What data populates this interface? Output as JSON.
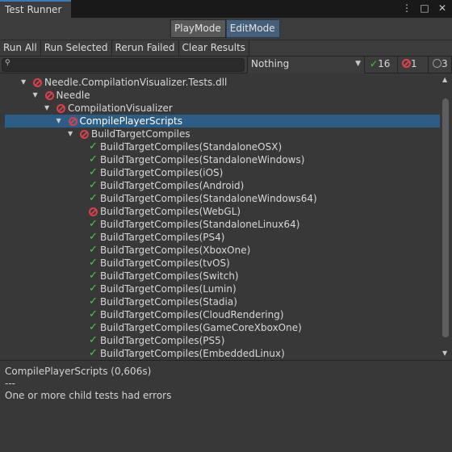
{
  "window": {
    "tab_title": "Test Runner",
    "icons": [
      "more-vertical-icon",
      "maximize-icon",
      "close-icon"
    ]
  },
  "modes": {
    "playmode": "PlayMode",
    "editmode": "EditMode",
    "active": "EditMode"
  },
  "toolbar": {
    "run_all": "Run All",
    "run_selected": "Run Selected",
    "rerun_failed": "Rerun Failed",
    "clear_results": "Clear Results"
  },
  "filter": {
    "search_value": "",
    "category_selected": "Nothing",
    "passed_count": "16",
    "failed_count": "1",
    "skipped_count": "3"
  },
  "tree": [
    {
      "label": "Needle.CompilationVisualizer.Tests.dll",
      "status": "failed",
      "expanded": true
    },
    {
      "label": "Needle",
      "status": "failed",
      "expanded": true
    },
    {
      "label": "CompilationVisualizer",
      "status": "failed",
      "expanded": true
    },
    {
      "label": "CompilePlayerScripts",
      "status": "failed",
      "expanded": true,
      "selected": true
    },
    {
      "label": "BuildTargetCompiles",
      "status": "failed",
      "expanded": true
    },
    {
      "label": "BuildTargetCompiles(StandaloneOSX)",
      "status": "passed"
    },
    {
      "label": "BuildTargetCompiles(StandaloneWindows)",
      "status": "passed"
    },
    {
      "label": "BuildTargetCompiles(iOS)",
      "status": "passed"
    },
    {
      "label": "BuildTargetCompiles(Android)",
      "status": "passed"
    },
    {
      "label": "BuildTargetCompiles(StandaloneWindows64)",
      "status": "passed"
    },
    {
      "label": "BuildTargetCompiles(WebGL)",
      "status": "failed"
    },
    {
      "label": "BuildTargetCompiles(StandaloneLinux64)",
      "status": "passed"
    },
    {
      "label": "BuildTargetCompiles(PS4)",
      "status": "passed"
    },
    {
      "label": "BuildTargetCompiles(XboxOne)",
      "status": "passed"
    },
    {
      "label": "BuildTargetCompiles(tvOS)",
      "status": "passed"
    },
    {
      "label": "BuildTargetCompiles(Switch)",
      "status": "passed"
    },
    {
      "label": "BuildTargetCompiles(Lumin)",
      "status": "passed"
    },
    {
      "label": "BuildTargetCompiles(Stadia)",
      "status": "passed"
    },
    {
      "label": "BuildTargetCompiles(CloudRendering)",
      "status": "passed"
    },
    {
      "label": "BuildTargetCompiles(GameCoreXboxOne)",
      "status": "passed"
    },
    {
      "label": "BuildTargetCompiles(PS5)",
      "status": "passed"
    },
    {
      "label": "BuildTargetCompiles(EmbeddedLinux)",
      "status": "passed"
    }
  ],
  "details": {
    "line1": "CompilePlayerScripts (0,606s)",
    "line2": "---",
    "line3": "One or more child tests had errors"
  },
  "colors": {
    "pass": "#3ccf3c",
    "fail": "#d8404a",
    "selection": "#2c5d87",
    "active_mode": "#46607c"
  }
}
